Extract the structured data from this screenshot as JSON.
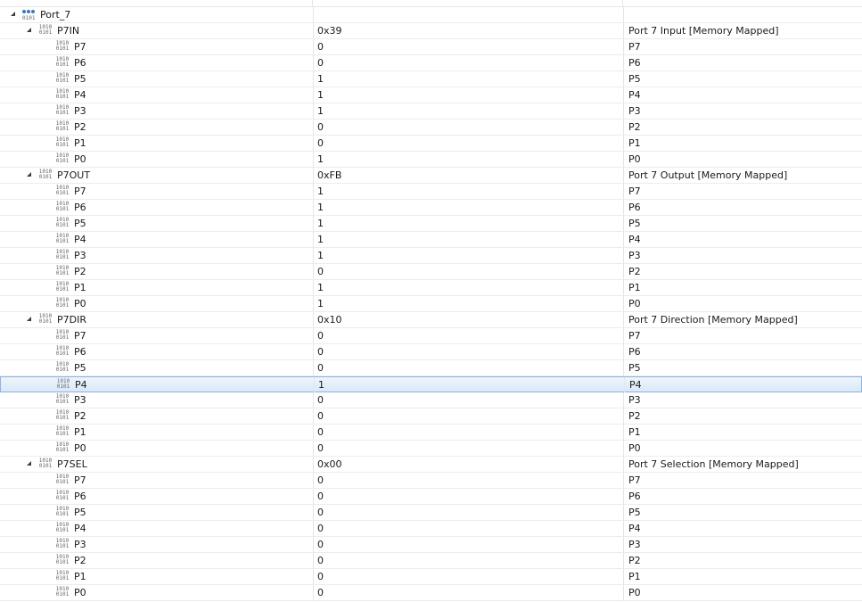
{
  "group": {
    "name": "Port_7",
    "icon": "register-group-icon"
  },
  "registers": [
    {
      "name": "P7IN",
      "value": "0x39",
      "description": "Port 7 Input [Memory Mapped]",
      "bits": [
        {
          "name": "P7",
          "value": "0",
          "description": "P7"
        },
        {
          "name": "P6",
          "value": "0",
          "description": "P6"
        },
        {
          "name": "P5",
          "value": "1",
          "description": "P5"
        },
        {
          "name": "P4",
          "value": "1",
          "description": "P4"
        },
        {
          "name": "P3",
          "value": "1",
          "description": "P3"
        },
        {
          "name": "P2",
          "value": "0",
          "description": "P2"
        },
        {
          "name": "P1",
          "value": "0",
          "description": "P1"
        },
        {
          "name": "P0",
          "value": "1",
          "description": "P0"
        }
      ]
    },
    {
      "name": "P7OUT",
      "value": "0xFB",
      "description": "Port 7 Output [Memory Mapped]",
      "bits": [
        {
          "name": "P7",
          "value": "1",
          "description": "P7"
        },
        {
          "name": "P6",
          "value": "1",
          "description": "P6"
        },
        {
          "name": "P5",
          "value": "1",
          "description": "P5"
        },
        {
          "name": "P4",
          "value": "1",
          "description": "P4"
        },
        {
          "name": "P3",
          "value": "1",
          "description": "P3"
        },
        {
          "name": "P2",
          "value": "0",
          "description": "P2"
        },
        {
          "name": "P1",
          "value": "1",
          "description": "P1"
        },
        {
          "name": "P0",
          "value": "1",
          "description": "P0"
        }
      ]
    },
    {
      "name": "P7DIR",
      "value": "0x10",
      "description": "Port 7 Direction [Memory Mapped]",
      "bits": [
        {
          "name": "P7",
          "value": "0",
          "description": "P7"
        },
        {
          "name": "P6",
          "value": "0",
          "description": "P6"
        },
        {
          "name": "P5",
          "value": "0",
          "description": "P5"
        },
        {
          "name": "P4",
          "value": "1",
          "description": "P4",
          "selected": true
        },
        {
          "name": "P3",
          "value": "0",
          "description": "P3"
        },
        {
          "name": "P2",
          "value": "0",
          "description": "P2"
        },
        {
          "name": "P1",
          "value": "0",
          "description": "P1"
        },
        {
          "name": "P0",
          "value": "0",
          "description": "P0"
        }
      ]
    },
    {
      "name": "P7SEL",
      "value": "0x00",
      "description": "Port 7 Selection [Memory Mapped]",
      "bits": [
        {
          "name": "P7",
          "value": "0",
          "description": "P7"
        },
        {
          "name": "P6",
          "value": "0",
          "description": "P6"
        },
        {
          "name": "P5",
          "value": "0",
          "description": "P5"
        },
        {
          "name": "P4",
          "value": "0",
          "description": "P4"
        },
        {
          "name": "P3",
          "value": "0",
          "description": "P3"
        },
        {
          "name": "P2",
          "value": "0",
          "description": "P2"
        },
        {
          "name": "P1",
          "value": "0",
          "description": "P1"
        },
        {
          "name": "P0",
          "value": "0",
          "description": "P0"
        }
      ]
    }
  ],
  "icons": {
    "register": "binary-register-icon",
    "bitfield": "binary-bitfield-icon",
    "expander": "expand-triangle-icon"
  },
  "colors": {
    "selected_bg": "#d9e8f8",
    "selected_border": "#8db2e3",
    "grid": "#ececec"
  }
}
